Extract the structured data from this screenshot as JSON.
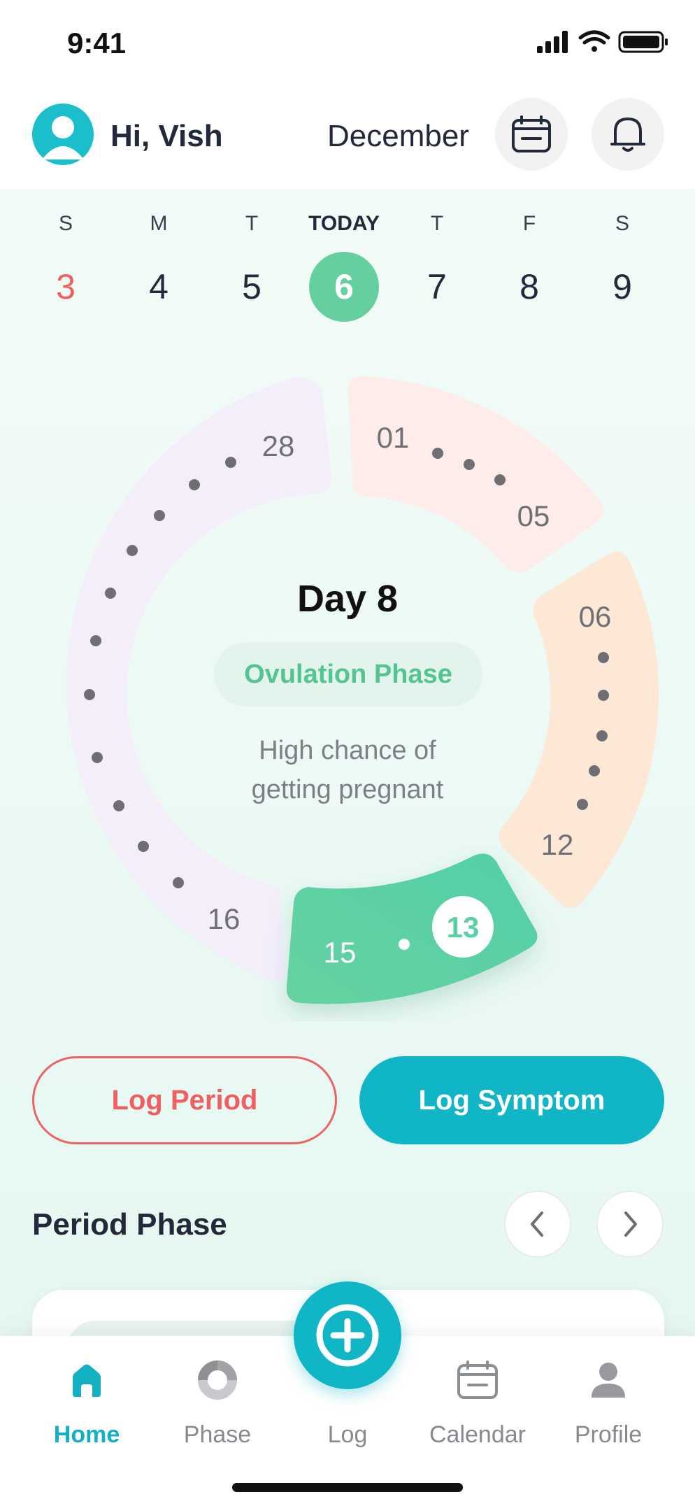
{
  "status_bar": {
    "time": "9:41"
  },
  "header": {
    "greeting": "Hi, Vish",
    "month": "December"
  },
  "week": {
    "days": [
      {
        "letter": "S",
        "number": "3"
      },
      {
        "letter": "M",
        "number": "4"
      },
      {
        "letter": "T",
        "number": "5"
      },
      {
        "letter": "TODAY",
        "number": "6"
      },
      {
        "letter": "T",
        "number": "7"
      },
      {
        "letter": "F",
        "number": "8"
      },
      {
        "letter": "S",
        "number": "9"
      }
    ]
  },
  "cycle": {
    "day_title": "Day 8",
    "phase_label": "Ovulation Phase",
    "description_line1": "High chance of",
    "description_line2": "getting pregnant",
    "period_start": "01",
    "period_end": "05",
    "follicular_start": "06",
    "follicular_end": "12",
    "ovulation_current": "13",
    "ovulation_end": "15",
    "luteal_start": "16",
    "luteal_end": "28",
    "colors": {
      "period": "#fdeceb",
      "follicular": "#fde9d8",
      "ovulation": "#5ccfa3",
      "luteal": "#f3ecfa"
    }
  },
  "actions": {
    "log_period": "Log Period",
    "log_symptom": "Log Symptom"
  },
  "section": {
    "title": "Period Phase"
  },
  "bottom_nav": {
    "home": "Home",
    "phase": "Phase",
    "log": "Log",
    "calendar": "Calendar",
    "profile": "Profile"
  },
  "accent": "#10b5c6"
}
